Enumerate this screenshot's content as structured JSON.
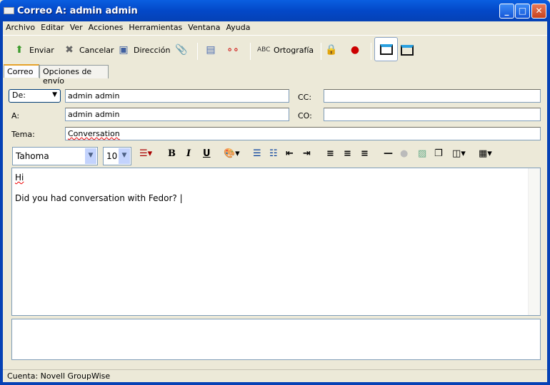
{
  "window": {
    "title": "Correo A: admin admin"
  },
  "menu": [
    "Archivo",
    "Editar",
    "Ver",
    "Acciones",
    "Herramientas",
    "Ventana",
    "Ayuda"
  ],
  "toolbar": {
    "send": "Enviar",
    "cancel": "Cancelar",
    "address": "Dirección",
    "spelling": "Ortografía"
  },
  "tabs": [
    "Correo",
    "Opciones de envío"
  ],
  "fields": {
    "from_label": "De:",
    "from_value": "admin admin",
    "to_label": "A:",
    "to_value": "admin admin",
    "cc_label": "CC:",
    "cc_value": "",
    "bc_label": "CO:",
    "bc_value": "",
    "subject_label": "Tema:",
    "subject_value": "Conversation"
  },
  "format": {
    "font": "Tahoma",
    "size": "10",
    "bold": "B",
    "italic": "I",
    "underline": "U"
  },
  "body": {
    "line1": "Hi",
    "line2": "Did you had conversation with Fedor?"
  },
  "status": {
    "account": "Cuenta: Novell GroupWise"
  }
}
